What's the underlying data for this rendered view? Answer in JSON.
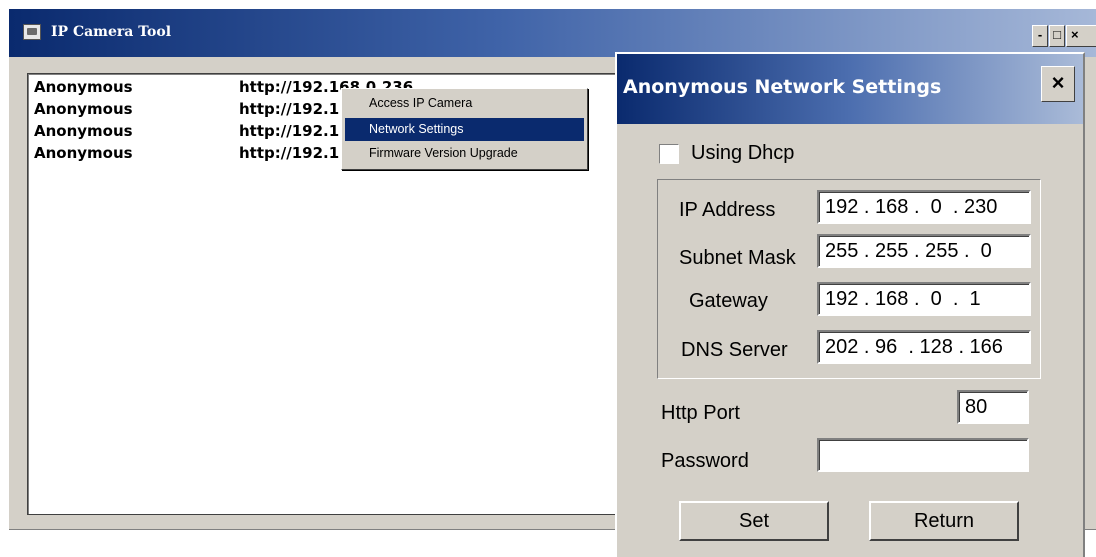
{
  "main_window": {
    "title": "IP Camera Tool",
    "controls": {
      "minimize": "-",
      "maximize": "□",
      "close": "×"
    }
  },
  "camera_list": [
    {
      "name": "Anonymous",
      "url": "http://192.168.0.236"
    },
    {
      "name": "Anonymous",
      "url": "http://192.1"
    },
    {
      "name": "Anonymous",
      "url": "http://192.1"
    },
    {
      "name": "Anonymous",
      "url": "http://192.1"
    }
  ],
  "context_menu": {
    "items": [
      {
        "label": "Access IP Camera",
        "selected": false
      },
      {
        "label": "Network Settings",
        "selected": true
      },
      {
        "label": "Firmware Version  Upgrade",
        "selected": false
      }
    ]
  },
  "dialog": {
    "title": "Anonymous Network Settings",
    "close_label": "×",
    "dhcp_label": "Using Dhcp",
    "dhcp_checked": false,
    "fields": {
      "ip_address": {
        "label": "IP Address",
        "value": "192 . 168 .  0  . 230"
      },
      "subnet_mask": {
        "label": "Subnet Mask",
        "value": "255 . 255 . 255 .  0"
      },
      "gateway": {
        "label": "Gateway",
        "value": "192 . 168 .  0  .  1"
      },
      "dns_server": {
        "label": "DNS Server",
        "value": "202 . 96  . 128 . 166"
      }
    },
    "http_port": {
      "label": "Http Port",
      "value": "80"
    },
    "password": {
      "label": "Password",
      "value": ""
    },
    "buttons": {
      "set": "Set",
      "return": "Return"
    }
  },
  "colors": {
    "titlebar_dark": "#0a2a6e",
    "titlebar_light": "#a6b8d8",
    "window_face": "#d4d0c8",
    "menu_highlight": "#0a2a6e"
  }
}
